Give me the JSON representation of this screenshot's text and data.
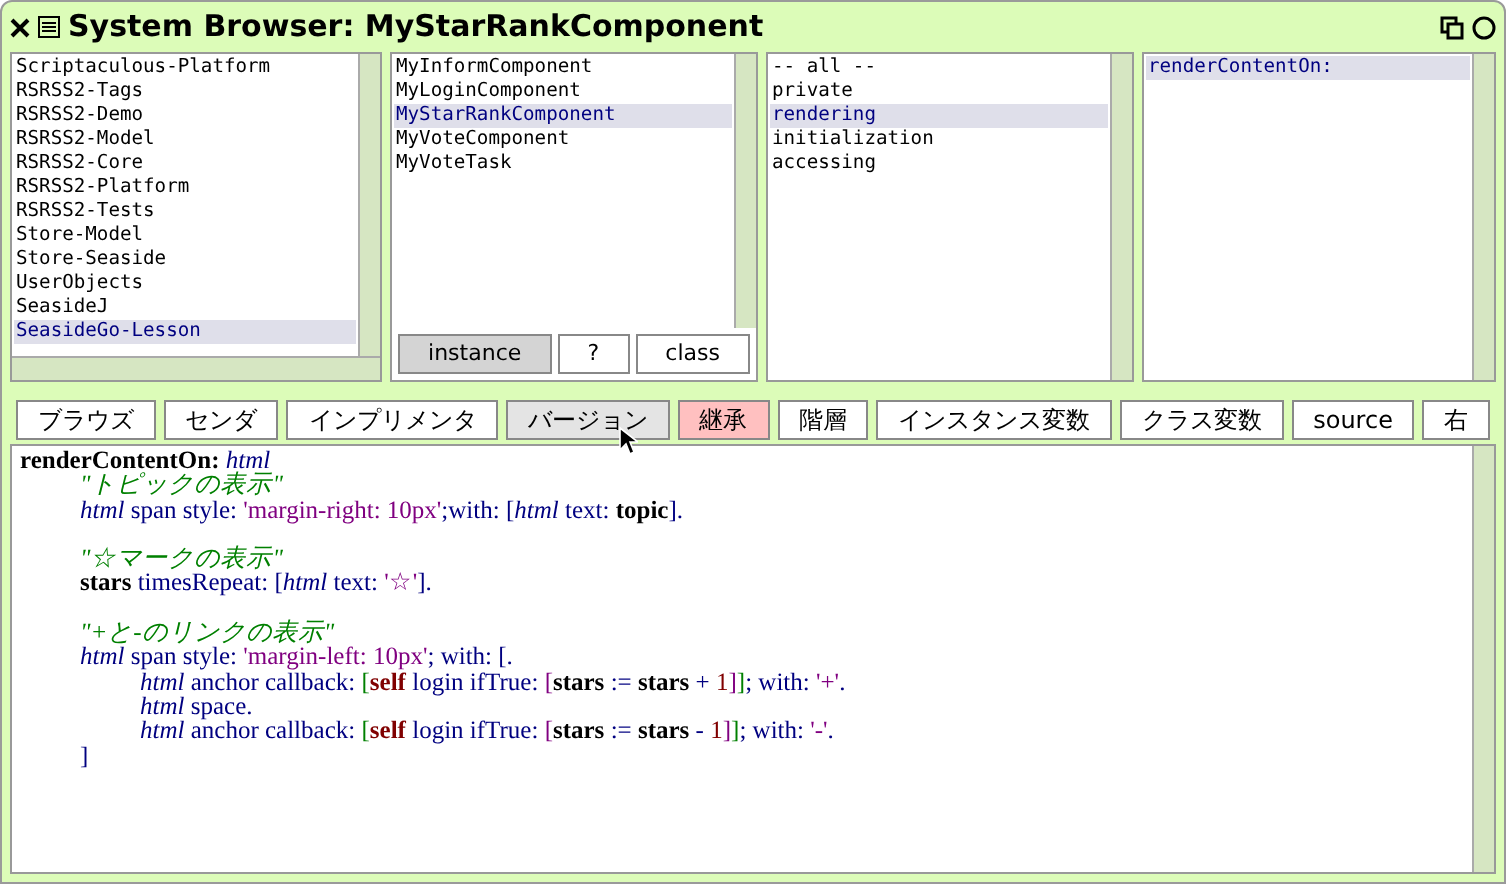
{
  "window": {
    "title": "System Browser: MyStarRankComponent"
  },
  "packages": [
    {
      "label": "Scriptaculous-Platform",
      "selected": false
    },
    {
      "label": "RSRSS2-Tags",
      "selected": false
    },
    {
      "label": "RSRSS2-Demo",
      "selected": false
    },
    {
      "label": "RSRSS2-Model",
      "selected": false
    },
    {
      "label": "RSRSS2-Core",
      "selected": false
    },
    {
      "label": "RSRSS2-Platform",
      "selected": false
    },
    {
      "label": "RSRSS2-Tests",
      "selected": false
    },
    {
      "label": "Store-Model",
      "selected": false
    },
    {
      "label": "Store-Seaside",
      "selected": false
    },
    {
      "label": "UserObjects",
      "selected": false
    },
    {
      "label": "SeasideJ",
      "selected": false
    },
    {
      "label": "SeasideGo-Lesson",
      "selected": true
    }
  ],
  "classes": [
    {
      "label": "MyInformComponent",
      "selected": false
    },
    {
      "label": "MyLoginComponent",
      "selected": false
    },
    {
      "label": "MyStarRankComponent",
      "selected": true
    },
    {
      "label": "MyVoteComponent",
      "selected": false
    },
    {
      "label": "MyVoteTask",
      "selected": false
    }
  ],
  "side_buttons": [
    {
      "label": "instance",
      "selected": true
    },
    {
      "label": "?",
      "selected": false
    },
    {
      "label": "class",
      "selected": false
    }
  ],
  "categories": [
    {
      "label": "-- all --",
      "selected": false
    },
    {
      "label": "private",
      "selected": false
    },
    {
      "label": "rendering",
      "selected": true
    },
    {
      "label": "initialization",
      "selected": false
    },
    {
      "label": "accessing",
      "selected": false
    }
  ],
  "methods": [
    {
      "label": "renderContentOn:",
      "selected": true
    }
  ],
  "toolbar": [
    {
      "label": "ブラウズ",
      "kind": "plain"
    },
    {
      "label": "センダ",
      "kind": "plain"
    },
    {
      "label": "インプリメンタ",
      "kind": "plain"
    },
    {
      "label": "バージョン",
      "kind": "hover"
    },
    {
      "label": "継承",
      "kind": "warning"
    },
    {
      "label": "階層",
      "kind": "plain"
    },
    {
      "label": "インスタンス変数",
      "kind": "plain"
    },
    {
      "label": "クラス変数",
      "kind": "plain"
    },
    {
      "label": "source",
      "kind": "plain"
    },
    {
      "label": "右",
      "kind": "plain"
    }
  ],
  "code": {
    "header": [
      {
        "kind": "ident",
        "text": "renderContentOn: "
      },
      {
        "kind": "arg",
        "text": "html"
      }
    ],
    "blocks": [
      {
        "lines": [
          {
            "tokens": [
              {
                "kind": "comment",
                "text": "\"トピックの表示\""
              }
            ]
          },
          {
            "tokens": [
              {
                "kind": "arg",
                "text": "html"
              },
              {
                "kind": "plain",
                "text": " span style: "
              },
              {
                "kind": "string",
                "text": "'margin-right: 10px'"
              },
              {
                "kind": "plain",
                "text": ";with: ["
              },
              {
                "kind": "arg",
                "text": "html"
              },
              {
                "kind": "plain",
                "text": " text: "
              },
              {
                "kind": "ident",
                "text": "topic"
              },
              {
                "kind": "plain",
                "text": "]."
              }
            ]
          }
        ]
      },
      {
        "lines": [
          {
            "tokens": [
              {
                "kind": "comment",
                "text": "\"☆マークの表示\""
              }
            ]
          },
          {
            "tokens": [
              {
                "kind": "ident",
                "text": "stars"
              },
              {
                "kind": "plain",
                "text": " timesRepeat: ["
              },
              {
                "kind": "arg",
                "text": "html"
              },
              {
                "kind": "plain",
                "text": " text: "
              },
              {
                "kind": "string",
                "text": "'☆'"
              },
              {
                "kind": "plain",
                "text": "]."
              }
            ]
          }
        ]
      },
      {
        "lines": [
          {
            "tokens": [
              {
                "kind": "comment",
                "text": "\"+と-のリンクの表示\""
              }
            ]
          },
          {
            "tokens": [
              {
                "kind": "arg",
                "text": "html"
              },
              {
                "kind": "plain",
                "text": " span style: "
              },
              {
                "kind": "string",
                "text": "'margin-left: 10px'"
              },
              {
                "kind": "plain",
                "text": "; with: [."
              }
            ],
            "children": [
              {
                "tokens": [
                  {
                    "kind": "arg",
                    "text": "html"
                  },
                  {
                    "kind": "plain",
                    "text": " anchor callback: "
                  },
                  {
                    "kind": "block",
                    "text": "["
                  },
                  {
                    "kind": "self",
                    "text": "self"
                  },
                  {
                    "kind": "plain",
                    "text": " login ifTrue: "
                  },
                  {
                    "kind": "inner",
                    "text": "["
                  },
                  {
                    "kind": "ident",
                    "text": "stars"
                  },
                  {
                    "kind": "plain",
                    "text": " := "
                  },
                  {
                    "kind": "ident",
                    "text": "stars"
                  },
                  {
                    "kind": "plain",
                    "text": " + "
                  },
                  {
                    "kind": "number",
                    "text": "1"
                  },
                  {
                    "kind": "inner",
                    "text": "]"
                  },
                  {
                    "kind": "block",
                    "text": "]"
                  },
                  {
                    "kind": "plain",
                    "text": "; with: "
                  },
                  {
                    "kind": "string",
                    "text": "'+'"
                  },
                  {
                    "kind": "plain",
                    "text": "."
                  }
                ]
              },
              {
                "tokens": [
                  {
                    "kind": "arg",
                    "text": "html"
                  },
                  {
                    "kind": "plain",
                    "text": " space."
                  }
                ]
              },
              {
                "tokens": [
                  {
                    "kind": "arg",
                    "text": "html"
                  },
                  {
                    "kind": "plain",
                    "text": " anchor callback: "
                  },
                  {
                    "kind": "block",
                    "text": "["
                  },
                  {
                    "kind": "self",
                    "text": "self"
                  },
                  {
                    "kind": "plain",
                    "text": " login ifTrue: "
                  },
                  {
                    "kind": "inner",
                    "text": "["
                  },
                  {
                    "kind": "ident",
                    "text": "stars"
                  },
                  {
                    "kind": "plain",
                    "text": " := "
                  },
                  {
                    "kind": "ident",
                    "text": "stars"
                  },
                  {
                    "kind": "plain",
                    "text": " - "
                  },
                  {
                    "kind": "number",
                    "text": "1"
                  },
                  {
                    "kind": "inner",
                    "text": "]"
                  },
                  {
                    "kind": "block",
                    "text": "]"
                  },
                  {
                    "kind": "plain",
                    "text": "; with: "
                  },
                  {
                    "kind": "string",
                    "text": "'-'"
                  },
                  {
                    "kind": "plain",
                    "text": "."
                  }
                ]
              }
            ]
          },
          {
            "tokens": [
              {
                "kind": "plain",
                "text": "]"
              }
            ]
          }
        ]
      }
    ]
  }
}
